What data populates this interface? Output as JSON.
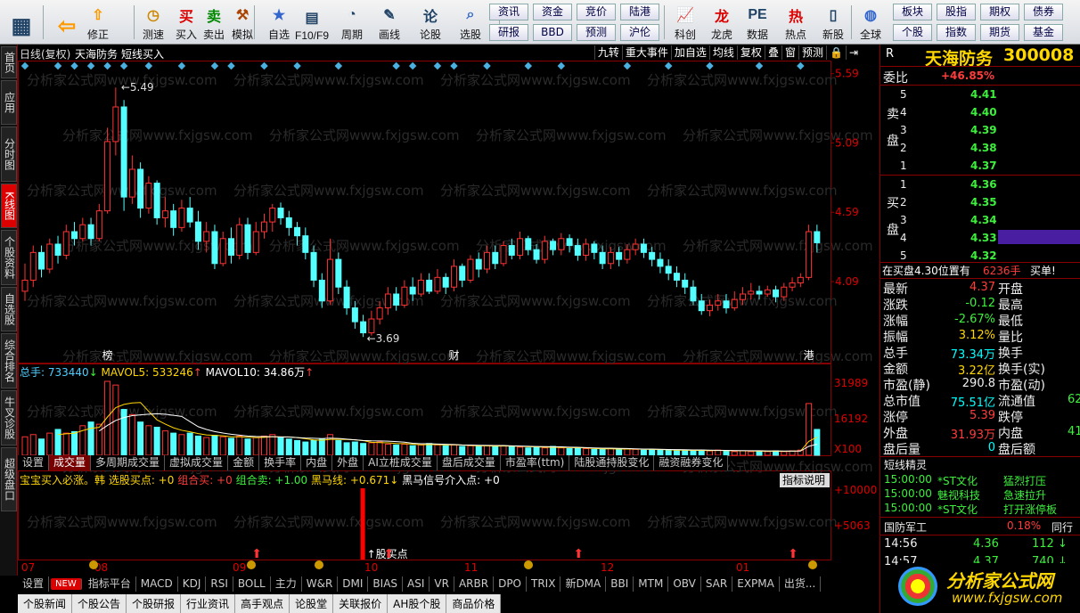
{
  "toolbar": {
    "buttons": [
      {
        "label": "",
        "icon": "grid-icon"
      },
      {
        "label": "",
        "icon": "back-arrow-icon"
      },
      {
        "label": "修正",
        "icon": "up-arrow-icon"
      },
      {
        "label": "测速",
        "icon": "clock-icon"
      },
      {
        "label": "买入",
        "icon": "buy-icon"
      },
      {
        "label": "卖出",
        "icon": "sell-icon"
      },
      {
        "label": "模拟",
        "icon": "hammer-icon"
      },
      {
        "label": "自选",
        "icon": "star-icon"
      },
      {
        "label": "F10/F9",
        "icon": "window-icon"
      },
      {
        "label": "周期",
        "icon": "period-icon"
      },
      {
        "label": "画线",
        "icon": "pen-icon"
      },
      {
        "label": "论股",
        "icon": "discuss-icon"
      },
      {
        "label": "选股",
        "icon": "search-icon"
      },
      {
        "label": "科创",
        "icon": "chart-icon"
      },
      {
        "label": "龙虎",
        "icon": "dragon-icon"
      },
      {
        "label": "数据",
        "icon": "pe-icon"
      },
      {
        "label": "热点",
        "icon": "hot-icon"
      },
      {
        "label": "新股",
        "icon": "new-stock-icon"
      },
      {
        "label": "全球",
        "icon": "globe-icon"
      }
    ],
    "small_buttons": [
      "资讯",
      "资金",
      "竞价",
      "陆港",
      "研报",
      "BBD",
      "预测",
      "沪伦",
      "板块",
      "股指",
      "期权",
      "债券",
      "个股",
      "指数",
      "期货",
      "基金"
    ]
  },
  "left_tabs": [
    "首页",
    "应用",
    "分时图",
    "K线图",
    "个股资料",
    "自选股",
    "综合排名",
    "牛叉诊股",
    "超级盘口"
  ],
  "chart_header": {
    "period": "日线(复权)",
    "name": "天海防务",
    "signal": "短线买入"
  },
  "chart_buttons": [
    "九转",
    "重大事件",
    "加自选",
    "均线",
    "复权",
    "叠",
    "窗",
    "预测"
  ],
  "y_axis": [
    "5.59",
    "5.09",
    "4.59",
    "4.09"
  ],
  "price_chart": {
    "high_label": "5.49",
    "low_label": "3.69",
    "markers": [
      "榜",
      "财",
      "港"
    ],
    "candles": [
      [
        4.02,
        4.1,
        4.22,
        3.95
      ],
      [
        4.1,
        4.3,
        4.35,
        4.05
      ],
      [
        4.3,
        4.18,
        4.35,
        4.12
      ],
      [
        4.18,
        4.36,
        4.4,
        4.15
      ],
      [
        4.36,
        4.28,
        4.42,
        4.22
      ],
      [
        4.28,
        4.45,
        4.5,
        4.25
      ],
      [
        4.45,
        4.4,
        4.52,
        4.35
      ],
      [
        4.4,
        4.5,
        4.55,
        4.38
      ],
      [
        4.5,
        4.4,
        4.55,
        4.35
      ],
      [
        4.4,
        4.6,
        4.65,
        4.38
      ],
      [
        4.6,
        5.1,
        5.2,
        4.58
      ],
      [
        5.1,
        5.35,
        5.49,
        5.0
      ],
      [
        5.35,
        4.7,
        5.4,
        4.6
      ],
      [
        4.7,
        4.9,
        5.0,
        4.65
      ],
      [
        4.9,
        4.62,
        4.95,
        4.55
      ],
      [
        4.62,
        4.8,
        4.85,
        4.58
      ],
      [
        4.8,
        4.55,
        4.82,
        4.5
      ],
      [
        4.55,
        4.6,
        4.7,
        4.48
      ],
      [
        4.6,
        4.48,
        4.65,
        4.42
      ],
      [
        4.48,
        4.62,
        4.68,
        4.45
      ],
      [
        4.62,
        4.52,
        4.7,
        4.48
      ],
      [
        4.52,
        4.38,
        4.6,
        4.32
      ],
      [
        4.38,
        4.45,
        4.52,
        4.3
      ],
      [
        4.45,
        4.22,
        4.5,
        4.18
      ],
      [
        4.22,
        4.4,
        4.45,
        4.2
      ],
      [
        4.4,
        4.28,
        4.48,
        4.22
      ],
      [
        4.28,
        4.5,
        4.55,
        4.25
      ],
      [
        4.5,
        4.3,
        4.55,
        4.25
      ],
      [
        4.3,
        4.45,
        4.52,
        4.28
      ],
      [
        4.45,
        4.52,
        4.58,
        4.4
      ],
      [
        4.52,
        4.62,
        4.65,
        4.45
      ],
      [
        4.62,
        4.55,
        4.66,
        4.5
      ],
      [
        4.55,
        4.48,
        4.6,
        4.42
      ],
      [
        4.48,
        4.42,
        4.52,
        4.35
      ],
      [
        4.42,
        4.3,
        4.48,
        4.25
      ],
      [
        4.3,
        4.1,
        4.35,
        4.05
      ],
      [
        4.1,
        3.95,
        4.15,
        3.9
      ],
      [
        3.95,
        4.25,
        4.4,
        3.92
      ],
      [
        4.25,
        4.05,
        4.3,
        4.0
      ],
      [
        4.05,
        3.9,
        4.1,
        3.85
      ],
      [
        3.9,
        3.8,
        3.95,
        3.75
      ],
      [
        3.8,
        3.72,
        3.85,
        3.69
      ],
      [
        3.72,
        3.82,
        3.88,
        3.7
      ],
      [
        3.82,
        3.9,
        3.95,
        3.78
      ],
      [
        3.9,
        4.0,
        4.05,
        3.85
      ],
      [
        4.0,
        3.92,
        4.05,
        3.88
      ],
      [
        3.92,
        4.05,
        4.1,
        3.9
      ],
      [
        4.05,
        4.0,
        4.12,
        3.95
      ],
      [
        4.0,
        4.1,
        4.15,
        3.98
      ],
      [
        4.1,
        4.02,
        4.15,
        4.0
      ],
      [
        4.02,
        4.12,
        4.18,
        4.0
      ],
      [
        4.12,
        4.05,
        4.15,
        4.0
      ],
      [
        4.05,
        4.2,
        4.25,
        4.02
      ],
      [
        4.2,
        4.1,
        4.22,
        4.05
      ],
      [
        4.1,
        4.25,
        4.28,
        4.08
      ],
      [
        4.25,
        4.18,
        4.3,
        4.12
      ],
      [
        4.18,
        4.3,
        4.35,
        4.15
      ],
      [
        4.3,
        4.22,
        4.35,
        4.18
      ],
      [
        4.22,
        4.35,
        4.38,
        4.2
      ],
      [
        4.35,
        4.28,
        4.4,
        4.25
      ],
      [
        4.28,
        4.4,
        4.45,
        4.25
      ],
      [
        4.4,
        4.32,
        4.42,
        4.28
      ],
      [
        4.32,
        4.25,
        4.36,
        4.22
      ],
      [
        4.25,
        4.38,
        4.42,
        4.22
      ],
      [
        4.38,
        4.32,
        4.4,
        4.28
      ],
      [
        4.32,
        4.4,
        4.44,
        4.28
      ],
      [
        4.4,
        4.35,
        4.43,
        4.3
      ],
      [
        4.35,
        4.28,
        4.4,
        4.24
      ],
      [
        4.28,
        4.36,
        4.4,
        4.24
      ],
      [
        4.36,
        4.3,
        4.38,
        4.25
      ],
      [
        4.3,
        4.22,
        4.35,
        4.18
      ],
      [
        4.22,
        4.3,
        4.34,
        4.18
      ],
      [
        4.3,
        4.25,
        4.34,
        4.2
      ],
      [
        4.25,
        4.32,
        4.36,
        4.22
      ],
      [
        4.32,
        4.36,
        4.4,
        4.28
      ],
      [
        4.36,
        4.3,
        4.4,
        4.26
      ],
      [
        4.3,
        4.25,
        4.34,
        4.2
      ],
      [
        4.25,
        4.2,
        4.3,
        4.15
      ],
      [
        4.2,
        4.15,
        4.25,
        4.1
      ],
      [
        4.15,
        4.1,
        4.2,
        4.05
      ],
      [
        4.1,
        4.05,
        4.15,
        4.0
      ],
      [
        4.05,
        3.95,
        4.1,
        3.92
      ],
      [
        3.95,
        3.88,
        4.0,
        3.85
      ],
      [
        3.88,
        3.92,
        3.96,
        3.84
      ],
      [
        3.92,
        3.95,
        4.0,
        3.88
      ],
      [
        3.95,
        3.9,
        4.0,
        3.86
      ],
      [
        3.9,
        3.96,
        4.02,
        3.88
      ],
      [
        3.96,
        4.0,
        4.05,
        3.92
      ],
      [
        4.0,
        4.02,
        4.08,
        3.96
      ],
      [
        4.02,
        4.0,
        4.06,
        3.96
      ],
      [
        4.0,
        4.03,
        4.06,
        3.98
      ],
      [
        4.03,
        3.98,
        4.06,
        3.94
      ],
      [
        3.98,
        4.05,
        4.08,
        3.95
      ],
      [
        4.05,
        4.08,
        4.12,
        4.02
      ],
      [
        4.08,
        4.12,
        4.15,
        4.05
      ],
      [
        4.12,
        4.45,
        4.5,
        4.1
      ],
      [
        4.45,
        4.37,
        4.5,
        4.3
      ]
    ],
    "signal_dots": [
      0,
      4,
      6,
      8,
      10,
      12,
      15,
      19,
      23,
      25,
      29,
      33,
      38,
      45,
      47,
      50,
      52,
      56,
      61,
      65,
      73,
      78,
      83,
      89,
      94
    ]
  },
  "volume": {
    "header_label": "总手: ",
    "header_value": "733440",
    "mavol5_label": "MAVOL5: ",
    "mavol5_value": "533246",
    "mavol10_label": "MAVOL10: ",
    "mavol10_value": "34.86万",
    "y_axis": [
      "31989",
      "16192",
      "X100"
    ],
    "bars": [
      0.25,
      0.28,
      0.22,
      0.3,
      0.35,
      0.3,
      0.32,
      0.4,
      0.45,
      0.42,
      1.0,
      0.95,
      0.62,
      0.55,
      0.45,
      0.4,
      0.38,
      0.33,
      0.3,
      0.28,
      0.3,
      0.26,
      0.24,
      0.27,
      0.25,
      0.23,
      0.26,
      0.22,
      0.24,
      0.26,
      0.28,
      0.24,
      0.22,
      0.2,
      0.18,
      0.2,
      0.22,
      0.28,
      0.2,
      0.17,
      0.18,
      0.16,
      0.17,
      0.18,
      0.15,
      0.14,
      0.15,
      0.13,
      0.14,
      0.16,
      0.14,
      0.13,
      0.14,
      0.12,
      0.13,
      0.12,
      0.13,
      0.12,
      0.13,
      0.12,
      0.11,
      0.1,
      0.11,
      0.1,
      0.12,
      0.1,
      0.09,
      0.1,
      0.09,
      0.08,
      0.08,
      0.09,
      0.08,
      0.09,
      0.08,
      0.07,
      0.08,
      0.07,
      0.07,
      0.06,
      0.07,
      0.06,
      0.07,
      0.06,
      0.07,
      0.06,
      0.05,
      0.06,
      0.05,
      0.06,
      0.05,
      0.06,
      0.05,
      0.06,
      0.07,
      0.7,
      0.35
    ]
  },
  "volume_tabs": [
    "设置",
    "成交量",
    "多周期成交量",
    "虚拟成交量",
    "金额",
    "换手率",
    "内盘",
    "外盘",
    "AI立桩成交量",
    "盘后成交量",
    "市盈率(ttm)",
    "陆股通持股变化",
    "融资融券变化"
  ],
  "indicator": {
    "title": "宝宝买入必涨。韩 选股买点: +0",
    "combo_buy": "组合买: +0",
    "combo_sell": "组合卖: +1.00",
    "heima": "黑马线: +0.671",
    "heima_signal": "黑马信号介入点: +0",
    "desc_button": "指标说明",
    "y_axis": [
      "+10000",
      "+5063"
    ],
    "buy_point": "股买点",
    "up_arrows": [
      28,
      44,
      67,
      93
    ]
  },
  "x_axis_months": [
    "07",
    "08",
    "09",
    "10",
    "11",
    "12",
    "01"
  ],
  "bottom_tabs": [
    "设置",
    "NEW",
    "指标平台",
    "MACD",
    "KDJ",
    "RSI",
    "BOLL",
    "主力",
    "W&R",
    "DMI",
    "BIAS",
    "ASI",
    "VR",
    "ARBR",
    "DPO",
    "TRIX",
    "新DMA",
    "BBI",
    "MTM",
    "OBV",
    "SAR",
    "EXPMA",
    "出货..."
  ],
  "news_tabs": [
    "个股新闻",
    "个股公告",
    "个股研报",
    "行业资讯",
    "高手观点",
    "论股堂",
    "关联报价",
    "AH股个股",
    "商品价格"
  ],
  "stock": {
    "name": "天海防务",
    "code": "300008",
    "flag": "R"
  },
  "orderbook": {
    "weibi_label": "委比",
    "weibi": "+46.85%",
    "sell_label": "卖盘",
    "buy_label": "买盘",
    "sell": [
      [
        "5",
        "4.41"
      ],
      [
        "4",
        "4.40"
      ],
      [
        "3",
        "4.39"
      ],
      [
        "2",
        "4.38"
      ],
      [
        "1",
        "4.37"
      ]
    ],
    "buy": [
      [
        "1",
        "4.36"
      ],
      [
        "2",
        "4.35"
      ],
      [
        "3",
        "4.34"
      ],
      [
        "4",
        "4.33"
      ],
      [
        "5",
        "4.32"
      ]
    ]
  },
  "bid_info": {
    "text": "在买盘4.30位置有",
    "vol": "6236手",
    "action": "买单!"
  },
  "quote": [
    [
      "最新",
      "4.37",
      "开盘",
      ""
    ],
    [
      "涨跌",
      "-0.12",
      "最高",
      ""
    ],
    [
      "涨幅",
      "-2.67%",
      "最低",
      ""
    ],
    [
      "振幅",
      "3.12%",
      "量比",
      ""
    ],
    [
      "总手",
      "73.34万",
      "换手",
      ""
    ],
    [
      "金额",
      "3.22亿",
      "换手(实)",
      ""
    ],
    [
      "市盈(静)",
      "290.8",
      "市盈(动)",
      ""
    ],
    [
      "总市值",
      "75.51亿",
      "流通值",
      "62"
    ],
    [
      "涨停",
      "5.39",
      "跌停",
      ""
    ],
    [
      "外盘",
      "31.93万",
      "内盘",
      "41"
    ],
    [
      "盘后量",
      "0",
      "盘后额",
      ""
    ]
  ],
  "short_term": {
    "title": "短线精灵",
    "items": [
      [
        "15:00:00",
        "*ST文化",
        "猛烈打压"
      ],
      [
        "15:00:00",
        "魅视科技",
        "急速拉升"
      ],
      [
        "15:00:00",
        "*ST文化",
        "打开涨停板"
      ]
    ]
  },
  "sector": {
    "name": "国防军工",
    "change": "0.18%",
    "label": "同行"
  },
  "ticks": [
    [
      "14:56",
      "4.36",
      "112"
    ],
    [
      "14:57",
      "4.37",
      "740"
    ]
  ],
  "watermark": "分析家公式网www.fxjgsw.com",
  "logo": {
    "title": "分析家公式网",
    "url": "www.fxjgsw.com"
  }
}
